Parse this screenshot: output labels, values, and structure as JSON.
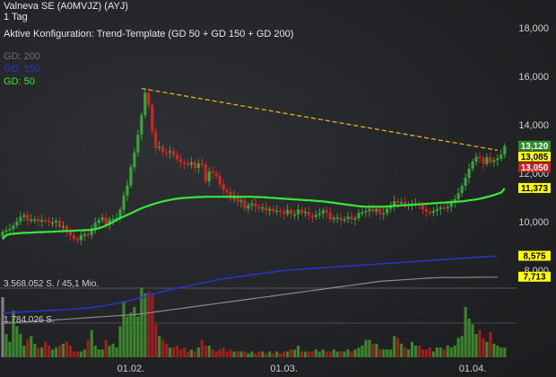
{
  "header": {
    "title": "Valneva SE (A0MVJZ) (AYJ)",
    "interval": "1 Tag",
    "config": "Aktive Konfiguration: Trend-Template (GD 50 + GD 150 + GD 200)"
  },
  "legend": [
    {
      "label": "GD: 200",
      "color": "#6e6e6e"
    },
    {
      "label": "GD: 150",
      "color": "#2a33c8"
    },
    {
      "label": "GD: 50",
      "color": "#38e838"
    }
  ],
  "volume_labels": [
    "3.568.052 S. / 45,1 Mio.",
    "1.784.026 S."
  ],
  "price_axis": {
    "ticks": [
      {
        "v": 18,
        "label": "18,000"
      },
      {
        "v": 16,
        "label": "16,000"
      },
      {
        "v": 14,
        "label": "14,000"
      },
      {
        "v": 12,
        "label": "12,000"
      },
      {
        "v": 10,
        "label": "10,000"
      },
      {
        "v": 8,
        "label": "8,000"
      }
    ]
  },
  "date_axis": [
    {
      "index": 36,
      "label": "01.02."
    },
    {
      "index": 79,
      "label": "01.03."
    },
    {
      "index": 132,
      "label": "01.04."
    }
  ],
  "badges": [
    {
      "value": 13.12,
      "label": "13,120",
      "bg": "#2c8c2c",
      "fg": "#ffffff"
    },
    {
      "value": 13.085,
      "label": "13,085",
      "bg": "#ffff00",
      "fg": "#000000"
    },
    {
      "value": 13.05,
      "label": "13,050",
      "bg": "#cc2020",
      "fg": "#ffffff"
    },
    {
      "value": 11.373,
      "label": "11,373",
      "bg": "#ffff00",
      "fg": "#000000"
    },
    {
      "value": 8.575,
      "label": "8,575",
      "bg": "#ffff00",
      "fg": "#000000"
    },
    {
      "value": 7.713,
      "label": "7,713",
      "bg": "#ffff00",
      "fg": "#000000"
    }
  ],
  "colors": {
    "up": "#3aa33a",
    "down": "#d02424",
    "ma50": "#38e838",
    "ma150": "#2a33c8",
    "ma200": "#8a8a8a",
    "trend": "#e8b020"
  },
  "chart_data": {
    "type": "candlestick",
    "closes": [
      9.58,
      9.64,
      9.7,
      9.84,
      10.01,
      10.2,
      10.27,
      10.05,
      10.09,
      10.1,
      10.01,
      10.07,
      10.03,
      9.97,
      9.97,
      10.04,
      9.78,
      9.81,
      9.58,
      9.44,
      9.29,
      9.24,
      9.45,
      9.49,
      9.45,
      9.71,
      9.95,
      10.07,
      10.17,
      9.87,
      10.09,
      10.11,
      10.15,
      10.5,
      11.08,
      11.5,
      12.25,
      12.86,
      13.59,
      14.39,
      15.32,
      14.81,
      13.73,
      13.05,
      13.1,
      12.86,
      12.85,
      12.91,
      12.76,
      12.58,
      12.44,
      12.41,
      12.35,
      12.45,
      12.22,
      12.41,
      12.34,
      11.67,
      12.08,
      12.01,
      11.89,
      11.55,
      11.31,
      11.22,
      10.95,
      11.07,
      10.83,
      10.87,
      10.54,
      10.68,
      10.75,
      10.62,
      10.54,
      10.59,
      10.46,
      10.53,
      10.43,
      10.46,
      10.41,
      10.32,
      10.49,
      10.3,
      10.3,
      10.5,
      10.35,
      10.41,
      10.27,
      10.19,
      10.28,
      10.35,
      10.47,
      10.38,
      10.1,
      10.15,
      10.18,
      10.07,
      10.11,
      10.21,
      10.09,
      10.14,
      10.37,
      10.39,
      10.44,
      10.53,
      10.42,
      10.53,
      10.31,
      10.35,
      10.54,
      10.65,
      10.85,
      10.79,
      10.81,
      10.69,
      10.71,
      10.73,
      10.74,
      10.67,
      10.51,
      10.41,
      10.37,
      10.44,
      10.52,
      10.59,
      10.55,
      10.61,
      10.81,
      10.93,
      11.18,
      11.48,
      11.81,
      12.19,
      12.48,
      12.68,
      12.63,
      12.38,
      12.66,
      12.46,
      12.54,
      12.61,
      12.77,
      13.12
    ],
    "ma50": [
      9.29,
      9.44,
      9.49,
      9.5,
      9.52,
      9.53,
      9.54,
      9.54,
      9.55,
      9.56,
      9.57,
      9.57,
      9.58,
      9.58,
      9.59,
      9.6,
      9.6,
      9.61,
      9.62,
      9.62,
      9.63,
      9.64,
      9.64,
      9.65,
      9.66,
      9.67,
      9.69,
      9.73,
      9.78,
      9.84,
      9.91,
      9.99,
      10.07,
      10.15,
      10.21,
      10.28,
      10.35,
      10.42,
      10.49,
      10.55,
      10.61,
      10.66,
      10.71,
      10.76,
      10.8,
      10.84,
      10.87,
      10.9,
      10.93,
      10.95,
      10.97,
      10.98,
      10.99,
      11.0,
      11.01,
      11.02,
      11.02,
      11.03,
      11.03,
      11.03,
      11.03,
      11.03,
      11.03,
      11.03,
      11.03,
      11.03,
      11.03,
      11.03,
      11.03,
      11.03,
      11.03,
      11.02,
      11.02,
      11.01,
      11.0,
      10.99,
      10.98,
      10.97,
      10.96,
      10.95,
      10.94,
      10.93,
      10.92,
      10.91,
      10.9,
      10.89,
      10.88,
      10.87,
      10.86,
      10.85,
      10.84,
      10.82,
      10.8,
      10.78,
      10.76,
      10.74,
      10.72,
      10.7,
      10.68,
      10.66,
      10.64,
      10.63,
      10.62,
      10.62,
      10.62,
      10.62,
      10.62,
      10.62,
      10.63,
      10.64,
      10.65,
      10.66,
      10.67,
      10.68,
      10.69,
      10.7,
      10.71,
      10.72,
      10.73,
      10.74,
      10.75,
      10.76,
      10.77,
      10.78,
      10.79,
      10.8,
      10.81,
      10.82,
      10.83,
      10.84,
      10.86,
      10.88,
      10.9,
      10.92,
      10.95,
      10.98,
      11.02,
      11.06,
      11.1,
      11.15,
      11.2,
      11.373
    ],
    "ma150": [
      6.24,
      6.24,
      6.25,
      6.26,
      6.27,
      6.27,
      6.28,
      6.29,
      6.3,
      6.3,
      6.31,
      6.32,
      6.33,
      6.33,
      6.34,
      6.35,
      6.36,
      6.37,
      6.38,
      6.39,
      6.4,
      6.41,
      6.42,
      6.43,
      6.44,
      6.46,
      6.48,
      6.5,
      6.52,
      6.54,
      6.57,
      6.6,
      6.63,
      6.66,
      6.69,
      6.72,
      6.76,
      6.8,
      6.84,
      6.88,
      6.92,
      6.96,
      7.0,
      7.04,
      7.08,
      7.12,
      7.16,
      7.2,
      7.23,
      7.26,
      7.29,
      7.32,
      7.35,
      7.38,
      7.41,
      7.44,
      7.47,
      7.5,
      7.53,
      7.56,
      7.59,
      7.62,
      7.65,
      7.67,
      7.69,
      7.71,
      7.73,
      7.75,
      7.77,
      7.79,
      7.81,
      7.83,
      7.85,
      7.87,
      7.89,
      7.91,
      7.93,
      7.95,
      7.97,
      7.99,
      8.0,
      8.01,
      8.02,
      8.03,
      8.04,
      8.05,
      8.06,
      8.07,
      8.08,
      8.09,
      8.1,
      8.11,
      8.12,
      8.13,
      8.14,
      8.15,
      8.16,
      8.17,
      8.18,
      8.19,
      8.2,
      8.21,
      8.22,
      8.23,
      8.24,
      8.25,
      8.26,
      8.27,
      8.28,
      8.29,
      8.3,
      8.31,
      8.32,
      8.33,
      8.34,
      8.35,
      8.36,
      8.37,
      8.38,
      8.39,
      8.4,
      8.41,
      8.42,
      8.43,
      8.44,
      8.45,
      8.46,
      8.47,
      8.48,
      8.49,
      8.5,
      8.51,
      8.52,
      8.53,
      8.54,
      8.55,
      8.56,
      8.565,
      8.57,
      8.575
    ],
    "ma200": [
      5.8,
      5.81,
      5.82,
      5.83,
      5.84,
      5.85,
      5.86,
      5.87,
      5.88,
      5.89,
      5.9,
      5.91,
      5.92,
      5.93,
      5.94,
      5.95,
      5.96,
      5.97,
      5.98,
      5.99,
      6.0,
      6.01,
      6.02,
      6.03,
      6.04,
      6.05,
      6.06,
      6.07,
      6.08,
      6.09,
      6.1,
      6.11,
      6.12,
      6.13,
      6.14,
      6.15,
      6.16,
      6.17,
      6.18,
      6.2,
      6.22,
      6.24,
      6.26,
      6.28,
      6.3,
      6.32,
      6.34,
      6.36,
      6.38,
      6.4,
      6.42,
      6.44,
      6.46,
      6.48,
      6.5,
      6.52,
      6.54,
      6.56,
      6.58,
      6.6,
      6.62,
      6.64,
      6.66,
      6.68,
      6.7,
      6.72,
      6.74,
      6.76,
      6.78,
      6.8,
      6.82,
      6.84,
      6.86,
      6.88,
      6.9,
      6.92,
      6.94,
      6.96,
      6.98,
      7.0,
      7.02,
      7.04,
      7.06,
      7.08,
      7.1,
      7.12,
      7.14,
      7.16,
      7.18,
      7.2,
      7.22,
      7.24,
      7.26,
      7.28,
      7.3,
      7.32,
      7.34,
      7.36,
      7.38,
      7.4,
      7.42,
      7.44,
      7.46,
      7.48,
      7.5,
      7.52,
      7.54,
      7.55,
      7.56,
      7.57,
      7.58,
      7.59,
      7.6,
      7.61,
      7.62,
      7.63,
      7.64,
      7.65,
      7.66,
      7.67,
      7.68,
      7.685,
      7.69,
      7.695,
      7.7,
      7.7,
      7.7,
      7.7,
      7.7,
      7.7,
      7.7,
      7.705,
      7.705,
      7.705,
      7.71,
      7.71,
      7.71,
      7.71,
      7.712,
      7.713
    ],
    "volumes": [
      3.1,
      1.2,
      0.8,
      2.4,
      1.6,
      1.2,
      0.6,
      0.9,
      1.1,
      0.7,
      0.5,
      0.5,
      0.8,
      0.6,
      0.4,
      0.5,
      0.6,
      0.7,
      0.8,
      0.6,
      0.3,
      0.3,
      0.3,
      0.4,
      0.9,
      1.4,
      0.6,
      0.4,
      0.4,
      0.9,
      0.6,
      0.7,
      0.5,
      1.6,
      2.9,
      2.1,
      2.3,
      2.6,
      2.1,
      3.6,
      3.3,
      3.4,
      3.3,
      1.7,
      1.1,
      0.9,
      0.7,
      0.5,
      0.5,
      0.6,
      0.4,
      0.5,
      0.3,
      0.4,
      0.3,
      0.5,
      0.9,
      0.6,
      0.6,
      0.4,
      0.3,
      0.4,
      0.5,
      0.3,
      0.4,
      0.3,
      0.3,
      0.3,
      0.3,
      0.2,
      0.3,
      0.2,
      0.3,
      0.3,
      0.2,
      0.3,
      0.2,
      0.3,
      0.2,
      0.3,
      0.3,
      0.4,
      0.4,
      0.6,
      0.3,
      0.3,
      0.3,
      0.3,
      0.4,
      0.3,
      0.4,
      0.3,
      0.3,
      0.4,
      0.3,
      0.3,
      0.3,
      0.4,
      0.3,
      0.4,
      0.5,
      0.6,
      0.9,
      0.9,
      0.7,
      0.7,
      0.4,
      0.4,
      0.4,
      0.4,
      1.1,
      1.0,
      0.7,
      0.5,
      0.4,
      0.8,
      0.6,
      0.6,
      0.4,
      0.4,
      0.5,
      0.3,
      0.5,
      0.5,
      0.4,
      0.6,
      0.5,
      0.6,
      1.0,
      1.1,
      2.6,
      2.0,
      1.7,
      1.2,
      1.4,
      1.0,
      0.8,
      1.3,
      0.7,
      0.6,
      0.5,
      0.5
    ],
    "trendline": {
      "from": {
        "index": 39,
        "value": 15.5
      },
      "to": {
        "index": 139,
        "value": 12.95
      }
    },
    "price_range": [
      7.0,
      18.7
    ],
    "volume_max": 3.568052
  }
}
